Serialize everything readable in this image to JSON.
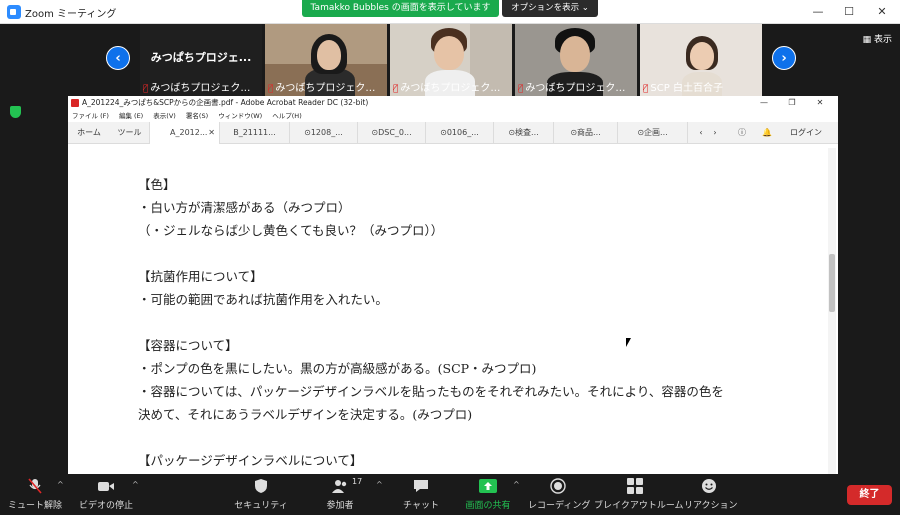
{
  "zoom": {
    "window_title": "Zoom ミーティング",
    "share_banner": "Tamakko Bubbles の画面を表示しています",
    "options_button": "オプションを表示 ⌄",
    "view_button": "▦ 表示"
  },
  "gallery": {
    "first_tile_big": "みつぱちプロジェ...",
    "tiles": [
      {
        "name": "みつばちプロジェクト..."
      },
      {
        "name": "みつばちプロジェクト..."
      },
      {
        "name": "みつばちプロジェクト..."
      },
      {
        "name": "みつばちプロジェクト..."
      },
      {
        "name": "SCP 白土百合子"
      }
    ],
    "prev_arrow": "‹",
    "next_arrow": "›"
  },
  "acrobat": {
    "title": "A_201224_みつぱち&SCPからの企画書.pdf - Adobe Acrobat Reader DC (32-bit)",
    "menu": [
      "ファイル (F)",
      "編集 (E)",
      "表示(V)",
      "署名(S)",
      "ウィンドウ(W)",
      "ヘルプ(H)"
    ],
    "tabs": {
      "home": "ホーム",
      "tools": "ツール",
      "docs": [
        "A_2012...",
        "B_21111...",
        "⊙1208_...",
        "⊙DSC_0...",
        "⊙0106_...",
        "⊙検査...",
        "⊙商品...",
        "⊙企画..."
      ],
      "login": "ログイン"
    },
    "document_lines": [
      "【色】",
      "・白い方が清潔感がある（みつプロ）",
      "（・ジェルならば少し黄色くても良い？（みつプロ））",
      "",
      "【抗菌作用について】",
      "・可能の範囲であれば抗菌作用を入れたい。",
      "",
      "【容器について】",
      "・ポンプの色を黒にしたい。黒の方が高級感がある。(SCP・みつプロ)",
      "・容器については、パッケージデザインラベルを貼ったものをそれぞれみたい。それにより、容器の色を",
      "決めて、それにあうラベルデザインを決定する。(みつプロ)",
      "",
      "【パッケージデザインラベルについて】"
    ]
  },
  "toolbar": {
    "mute": "ミュート解除",
    "video": "ビデオの停止",
    "security": "セキュリティ",
    "participants": "参加者",
    "participant_count": "17",
    "chat": "チャット",
    "share": "画面の共有",
    "record": "レコーディング",
    "breakout": "ブレイクアウトルーム",
    "reactions": "リアクション",
    "end": "終了"
  },
  "colors": {
    "zoom_blue": "#0e71eb",
    "share_green": "#23c252",
    "end_red": "#d42a2a"
  }
}
